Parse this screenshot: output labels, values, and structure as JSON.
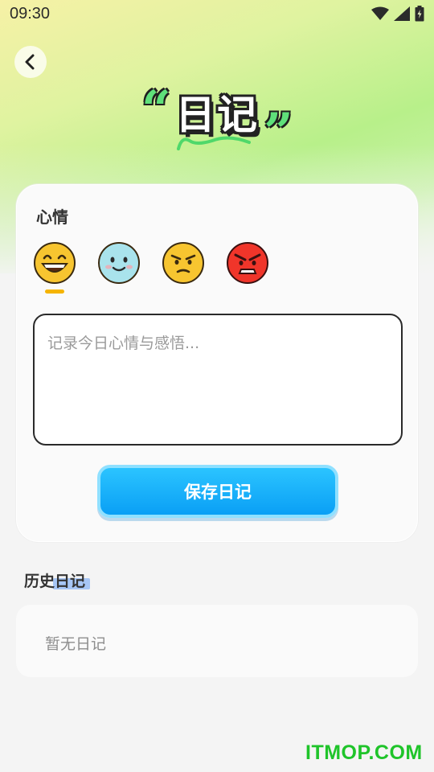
{
  "status_bar": {
    "time": "09:30"
  },
  "header": {
    "title": "日记",
    "quote_open": "“",
    "quote_close": "”"
  },
  "mood_section": {
    "label": "心情",
    "moods": [
      {
        "icon": "grinning-face-icon",
        "color": "#f7c530",
        "selected": true
      },
      {
        "icon": "smiling-face-icon",
        "color": "#a9e3ec",
        "selected": false
      },
      {
        "icon": "annoyed-face-icon",
        "color": "#f7c530",
        "selected": false
      },
      {
        "icon": "angry-face-icon",
        "color": "#f0352a",
        "selected": false
      }
    ]
  },
  "diary_input": {
    "value": "",
    "placeholder": "记录今日心情与感悟..."
  },
  "save_button": {
    "label": "保存日记"
  },
  "history": {
    "title": "历史日记",
    "empty_text": "暂无日记"
  },
  "watermark": {
    "text": "ITMOP.COM"
  },
  "colors": {
    "accent": "#0a9ff5",
    "title_green": "#5fe07a",
    "selected_indicator": "#f5b400"
  }
}
